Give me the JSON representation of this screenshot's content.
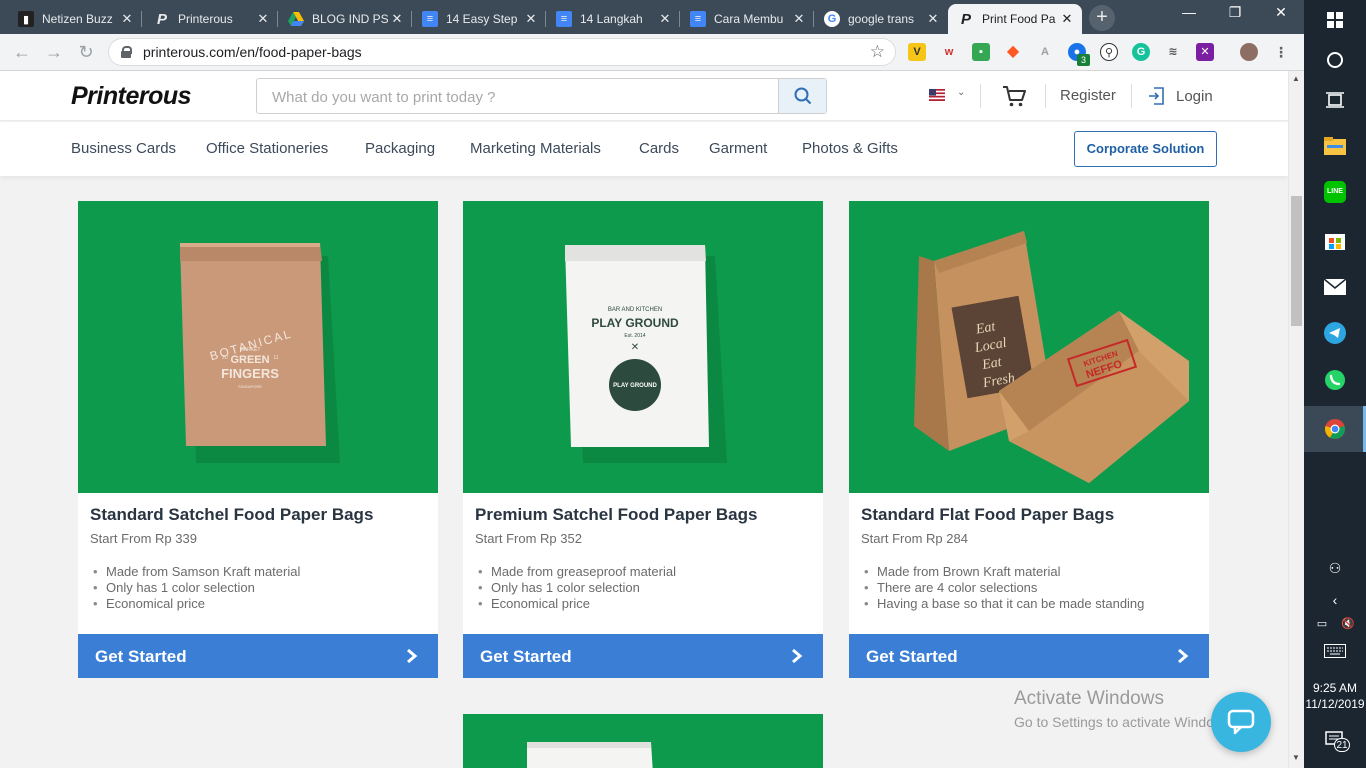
{
  "browser": {
    "tabs": [
      {
        "title": "Netizen Buzz",
        "favicon": "netizen-favicon",
        "active": false
      },
      {
        "title": "Printerous",
        "favicon": "printerous-favicon",
        "active": false
      },
      {
        "title": "BLOG IND PS",
        "favicon": "google-drive-favicon",
        "active": false
      },
      {
        "title": "14 Easy Step",
        "favicon": "google-docs-favicon",
        "active": false
      },
      {
        "title": "14 Langkah",
        "favicon": "google-docs-favicon",
        "active": false
      },
      {
        "title": "Cara Membu",
        "favicon": "google-docs-favicon",
        "active": false
      },
      {
        "title": "google trans",
        "favicon": "google-favicon",
        "active": false
      },
      {
        "title": "Print Food Pa",
        "favicon": "printerous-favicon",
        "active": true
      }
    ],
    "new_tab": "+",
    "url": "printerous.com/en/food-paper-bags",
    "extension_badge": "3"
  },
  "site": {
    "logo": "Printerous",
    "search_placeholder": "What do you want to print today ?",
    "register": "Register",
    "login": "Login",
    "nav": [
      "Business Cards",
      "Office Stationeries",
      "Packaging",
      "Marketing Materials",
      "Cards",
      "Garment",
      "Photos & Gifts"
    ],
    "corporate_button": "Corporate Solution"
  },
  "products": [
    {
      "name": "Standard Satchel Food Paper Bags",
      "price": "Start From Rp 339",
      "features": [
        "Made from Samson Kraft material",
        "Only has 1 color selection",
        "Economical price"
      ],
      "cta": "Get Started",
      "bag_text": {
        "line1": "BOTANICAL",
        "line2": "MARKET",
        "line3": "GREEN",
        "line4": "FINGERS",
        "line5": "SINGAPORE",
        "year_left": "20",
        "year_right": "11"
      }
    },
    {
      "name": "Premium Satchel Food Paper Bags",
      "price": "Start From Rp 352",
      "features": [
        "Made from greaseproof material",
        "Only has 1 color selection",
        "Economical price"
      ],
      "cta": "Get Started",
      "bag_text": {
        "line1": "BAR AND KITCHEN",
        "line2": "PLAY GROUND",
        "line3": "Est. 2014",
        "badge": "PLAY GROUND"
      }
    },
    {
      "name": "Standard Flat Food Paper Bags",
      "price": "Start From Rp 284",
      "features": [
        "Made from Brown Kraft material",
        "There are 4 color selections",
        "Having a base so that it can be made standing"
      ],
      "cta": "Get Started",
      "bag_text": {
        "line1": "Eat",
        "line2": "Local",
        "line3": "Eat",
        "line4": "Fresh",
        "stamp1": "KITCHEN",
        "stamp2": "NEFFO"
      }
    }
  ],
  "watermark": {
    "title": "Activate Windows",
    "subtitle": "Go to Settings to activate Windows."
  },
  "system": {
    "time": "9:25 AM",
    "date": "11/12/2019",
    "notifications": "21"
  },
  "colors": {
    "brand_green": "#0e9a4c",
    "cta_blue": "#3a7fd5",
    "corporate_blue": "#1f5fa6",
    "chat_cyan": "#38b6e0"
  }
}
